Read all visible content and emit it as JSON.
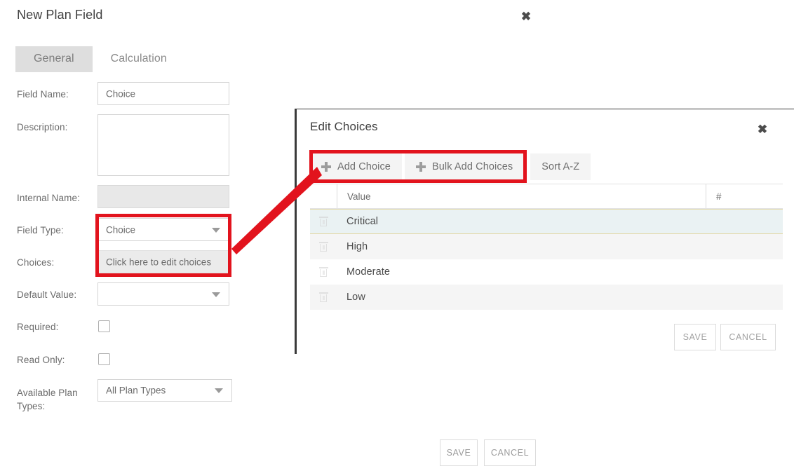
{
  "plan_dialog": {
    "title": "New Plan Field",
    "close_icon": "close-icon",
    "tabs": [
      {
        "label": "General",
        "active": true
      },
      {
        "label": "Calculation",
        "active": false
      }
    ],
    "fields": {
      "field_name": {
        "label": "Field Name:",
        "value": "Choice"
      },
      "description": {
        "label": "Description:",
        "value": ""
      },
      "internal_name": {
        "label": "Internal Name:",
        "value": ""
      },
      "field_type": {
        "label": "Field Type:",
        "value": "Choice"
      },
      "choices": {
        "label": "Choices:",
        "value": "Click here to edit choices"
      },
      "default_value": {
        "label": "Default Value:",
        "value": ""
      },
      "required": {
        "label": "Required:",
        "checked": false
      },
      "read_only": {
        "label": "Read Only:",
        "checked": false
      },
      "available_plan_types": {
        "label": "Available Plan Types:",
        "value": "All Plan Types"
      }
    },
    "buttons": {
      "save": "SAVE",
      "cancel": "CANCEL"
    }
  },
  "choices_panel": {
    "title": "Edit Choices",
    "close_icon": "close-icon",
    "toolbar": {
      "add_choice": "Add Choice",
      "bulk_add_choices": "Bulk Add Choices",
      "sort_az": "Sort A-Z"
    },
    "table": {
      "columns": [
        "",
        "Value",
        "#"
      ],
      "rows": [
        {
          "value": "Critical",
          "num": "",
          "selected": true
        },
        {
          "value": "High",
          "num": "",
          "selected": false
        },
        {
          "value": "Moderate",
          "num": "",
          "selected": false
        },
        {
          "value": "Low",
          "num": "",
          "selected": false
        }
      ]
    },
    "buttons": {
      "save": "SAVE",
      "cancel": "CANCEL"
    }
  },
  "annotations": {
    "highlight_color": "#e2131d",
    "arrow": "red-callout-arrow"
  }
}
